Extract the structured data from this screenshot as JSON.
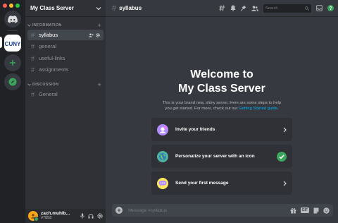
{
  "window": {
    "traffic_lights": [
      "#ff5f57",
      "#febc2e",
      "#28c840"
    ]
  },
  "servers": {
    "home_icon": "discord-logo-icon",
    "items": [
      {
        "name": "My Class Server",
        "icon": "cuny-logo",
        "logo_text": "CUNY",
        "selected": true
      }
    ],
    "add_icon": "plus-icon",
    "explore_icon": "compass-icon"
  },
  "sidebar": {
    "server_name": "My Class Server",
    "categories": [
      {
        "name": "INFORMATION",
        "channels": [
          {
            "name": "syllabus",
            "active": true
          },
          {
            "name": "general",
            "active": false
          },
          {
            "name": "useful-links",
            "active": false
          },
          {
            "name": "assignments",
            "active": false
          }
        ]
      },
      {
        "name": "DISCUSSION",
        "channels": [
          {
            "name": "General",
            "active": false
          }
        ]
      }
    ]
  },
  "user": {
    "name": "zach.muhlb...",
    "tag": "#7858",
    "status_color": "#3ba55d"
  },
  "topbar": {
    "channel": "syllabus",
    "search_placeholder": "Search"
  },
  "welcome": {
    "title_line1": "Welcome to",
    "title_line2": "My Class Server",
    "desc_line1": "This is your brand new, shiny server. Here are some steps to help",
    "desc_line2_prefix": "you get started. For more, check out our ",
    "desc_link": "Getting Started guide",
    "desc_suffix": "."
  },
  "cards": [
    {
      "label": "Invite your friends",
      "completed": false
    },
    {
      "label": "Personalize your server with an icon",
      "completed": true
    },
    {
      "label": "Send your first message",
      "completed": false
    }
  ],
  "composer": {
    "placeholder": "Message #syllabus",
    "gif_label": "GIF"
  },
  "colors": {
    "accent_link": "#00aff4",
    "success": "#3ba55d",
    "explore": "#3ba55d"
  }
}
